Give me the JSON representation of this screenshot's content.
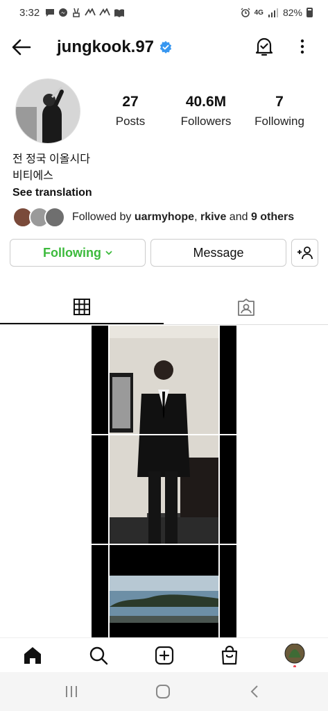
{
  "status_bar": {
    "time": "3:32",
    "battery_percent": "82%",
    "network": "4G"
  },
  "header": {
    "username": "jungkook.97",
    "verified": true
  },
  "profile": {
    "stats": [
      {
        "value": "27",
        "label": "Posts"
      },
      {
        "value": "40.6M",
        "label": "Followers"
      },
      {
        "value": "7",
        "label": "Following"
      }
    ],
    "bio_line1": "전 정국 이올시다",
    "bio_line2": "비티에스",
    "see_translation": "See translation"
  },
  "followed_by": {
    "prefix": "Followed by ",
    "user1": "uarmyhope",
    "sep": ", ",
    "user2": "rkive",
    "mid": " and ",
    "others": "9 others"
  },
  "actions": {
    "following_label": "Following",
    "message_label": "Message"
  },
  "colors": {
    "following_green": "#3cba3c",
    "verified_blue": "#3897f0",
    "notification_dot": "#ed4956"
  }
}
